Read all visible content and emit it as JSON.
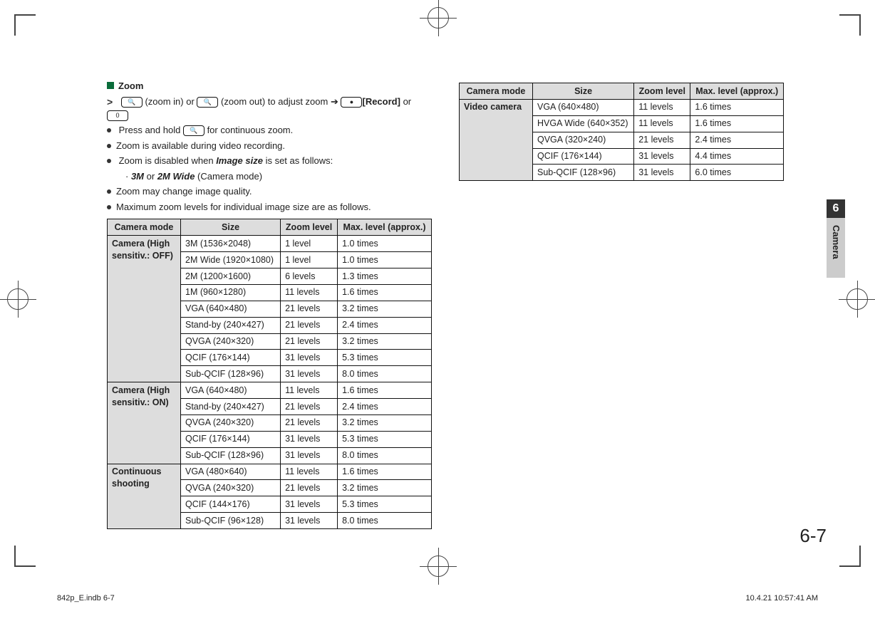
{
  "heading": "Zoom",
  "instructions": {
    "chevron_line_a": "(zoom in) or",
    "chevron_line_b": "(zoom out) to adjust zoom",
    "record_label": "[Record]",
    "or_text": "or",
    "bullets": [
      "Press and hold        for continuous zoom.",
      "Zoom is available during video recording.",
      "Zoom is disabled when Image size is set as follows:",
      "Zoom may change image quality.",
      "Maximum zoom levels for individual image size are as follows."
    ],
    "disabled_detail": "· 3M or 2M Wide (Camera mode)"
  },
  "table_headers": [
    "Camera mode",
    "Size",
    "Zoom level",
    "Max. level (approx.)"
  ],
  "left_table": [
    {
      "mode": "Camera (High sensitiv.: OFF)",
      "rows": [
        {
          "size": "3M (1536×2048)",
          "zoom": "1 level",
          "max": "1.0 times"
        },
        {
          "size": "2M Wide (1920×1080)",
          "zoom": "1 level",
          "max": "1.0 times"
        },
        {
          "size": "2M (1200×1600)",
          "zoom": "6 levels",
          "max": "1.3 times"
        },
        {
          "size": "1M (960×1280)",
          "zoom": "11 levels",
          "max": "1.6 times"
        },
        {
          "size": "VGA (640×480)",
          "zoom": "21 levels",
          "max": "3.2 times"
        },
        {
          "size": "Stand-by (240×427)",
          "zoom": "21 levels",
          "max": "2.4 times"
        },
        {
          "size": "QVGA (240×320)",
          "zoom": "21 levels",
          "max": "3.2 times"
        },
        {
          "size": "QCIF (176×144)",
          "zoom": "31 levels",
          "max": "5.3 times"
        },
        {
          "size": "Sub-QCIF (128×96)",
          "zoom": "31 levels",
          "max": "8.0 times"
        }
      ]
    },
    {
      "mode": "Camera (High sensitiv.: ON)",
      "rows": [
        {
          "size": "VGA (640×480)",
          "zoom": "11 levels",
          "max": "1.6 times"
        },
        {
          "size": "Stand-by (240×427)",
          "zoom": "21 levels",
          "max": "2.4 times"
        },
        {
          "size": "QVGA (240×320)",
          "zoom": "21 levels",
          "max": "3.2 times"
        },
        {
          "size": "QCIF (176×144)",
          "zoom": "31 levels",
          "max": "5.3 times"
        },
        {
          "size": "Sub-QCIF (128×96)",
          "zoom": "31 levels",
          "max": "8.0 times"
        }
      ]
    },
    {
      "mode": "Continuous shooting",
      "rows": [
        {
          "size": "VGA (480×640)",
          "zoom": "11 levels",
          "max": "1.6 times"
        },
        {
          "size": "QVGA (240×320)",
          "zoom": "21 levels",
          "max": "3.2 times"
        },
        {
          "size": "QCIF (144×176)",
          "zoom": "31 levels",
          "max": "5.3 times"
        },
        {
          "size": "Sub-QCIF (96×128)",
          "zoom": "31 levels",
          "max": "8.0 times"
        }
      ]
    }
  ],
  "right_table": [
    {
      "mode": "Video camera",
      "rows": [
        {
          "size": "VGA (640×480)",
          "zoom": "11 levels",
          "max": "1.6 times"
        },
        {
          "size": "HVGA Wide (640×352)",
          "zoom": "11 levels",
          "max": "1.6 times"
        },
        {
          "size": "QVGA (320×240)",
          "zoom": "21 levels",
          "max": "2.4 times"
        },
        {
          "size": "QCIF (176×144)",
          "zoom": "31 levels",
          "max": "4.4 times"
        },
        {
          "size": "Sub-QCIF (128×96)",
          "zoom": "31 levels",
          "max": "6.0 times"
        }
      ]
    }
  ],
  "sidebar": {
    "number": "6",
    "label": "Camera"
  },
  "page_number": "6-7",
  "footer_left": "842p_E.indb   6-7",
  "footer_right": "10.4.21   10:57:41 AM"
}
